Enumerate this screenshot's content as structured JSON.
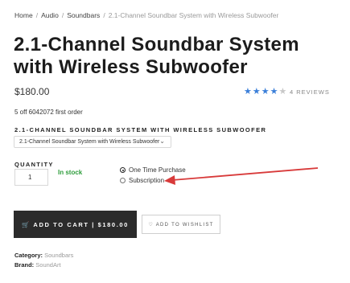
{
  "breadcrumb": {
    "home": "Home",
    "audio": "Audio",
    "soundbars": "Soundbars",
    "current": "2.1-Channel Soundbar System with Wireless Subwoofer",
    "separator": "/"
  },
  "product": {
    "title": "2.1-Channel Soundbar System with Wireless Subwoofer",
    "price": "$180.00",
    "rating": 4,
    "rating_max": 5,
    "reviews": "4 REVIEWS",
    "promo": "5 off 6042072 first order",
    "variant_label": "2.1-CHANNEL SOUNDBAR SYSTEM WITH WIRELESS SUBWOOFER",
    "variant_value": "2.1-Channel Soundbar System with Wireless Subwoofer"
  },
  "purchase": {
    "quantity_label": "QUANTITY",
    "quantity_value": "1",
    "stock": "In stock",
    "option_one_time": "One Time Purchase",
    "option_subscription": "Subscription",
    "selected_option": "one_time",
    "add_to_cart": "ADD TO CART | $180.00",
    "add_to_wishlist": "ADD TO WISHLIST"
  },
  "meta": {
    "category_label": "Category:",
    "category_value": "Soundbars",
    "brand_label": "Brand:",
    "brand_value": "SoundArt"
  },
  "colors": {
    "accent_star": "#3b7fd9",
    "stock_green": "#2e9d3c",
    "cart_button": "#2b2b2b",
    "annotation_arrow": "#d83a3a"
  }
}
